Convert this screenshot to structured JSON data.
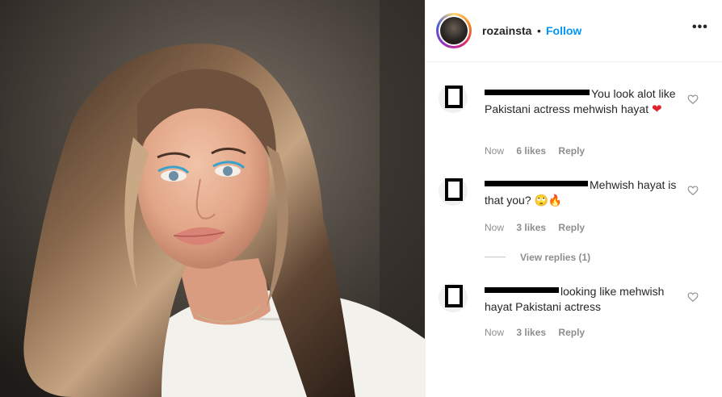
{
  "header": {
    "username": "rozainsta",
    "separator": "•",
    "follow_label": "Follow",
    "more_icon": "more-horizontal-icon"
  },
  "comments": [
    {
      "text": "You look alot like Pakistani actress mehwish hayat",
      "emoji": "❤",
      "time": "Now",
      "likes": "6 likes",
      "reply_label": "Reply"
    },
    {
      "text": "Mehwish hayat is that you?",
      "emoji": "🙄🔥",
      "time": "Now",
      "likes": "3 likes",
      "reply_label": "Reply",
      "view_replies": "View replies (1)"
    },
    {
      "text": "looking like mehwish hayat Pakistani actress",
      "emoji": "",
      "time": "Now",
      "likes": "3 likes",
      "reply_label": "Reply"
    }
  ],
  "colors": {
    "follow_blue": "#0095f6",
    "meta_gray": "#8e8e8e",
    "text_dark": "#262626"
  }
}
